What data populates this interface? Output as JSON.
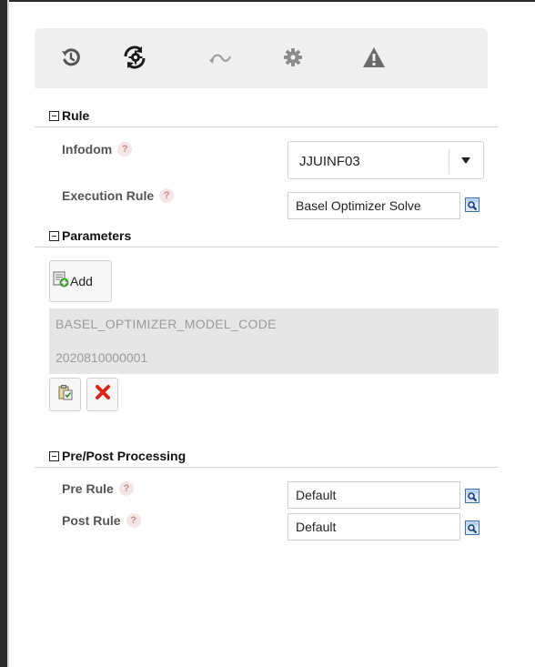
{
  "toolbar": {
    "icons": [
      "history-icon",
      "process-settings-icon",
      "forward-arrow-icon",
      "gear-icon",
      "warning-icon"
    ]
  },
  "rule_section": {
    "title": "Rule",
    "infodom": {
      "label": "Infodom",
      "help": "?",
      "value": "JJUINF03"
    },
    "execution_rule": {
      "label": "Execution Rule",
      "help": "?",
      "value": "Basel Optimizer Solve"
    }
  },
  "parameters_section": {
    "title": "Parameters",
    "add_label": "Add",
    "parameter": {
      "name": "BASEL_OPTIMIZER_MODEL_CODE",
      "value": "2020810000001"
    }
  },
  "prepost_section": {
    "title": "Pre/Post Processing",
    "pre_rule": {
      "label": "Pre Rule",
      "help": "?",
      "value": "Default"
    },
    "post_rule": {
      "label": "Post Rule",
      "help": "?",
      "value": "Default"
    }
  },
  "colors": {
    "help_bg": "#f4e6e6",
    "help_fg": "#c98a8a",
    "delete_red": "#d9261c",
    "toolbar_bg": "#efefef"
  }
}
